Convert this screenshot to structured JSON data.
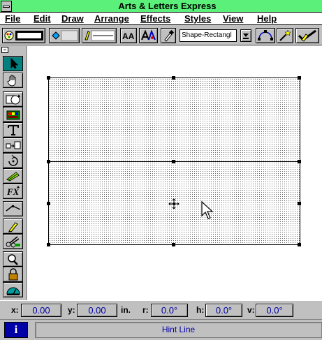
{
  "window": {
    "title": "Arts & Letters Express"
  },
  "menubar": [
    {
      "key": "file",
      "label": "File"
    },
    {
      "key": "edit",
      "label": "Edit"
    },
    {
      "key": "draw",
      "label": "Draw"
    },
    {
      "key": "arrange",
      "label": "Arrange"
    },
    {
      "key": "effects",
      "label": "Effects"
    },
    {
      "key": "styles",
      "label": "Styles"
    },
    {
      "key": "view",
      "label": "View"
    },
    {
      "key": "help",
      "label": "Help"
    }
  ],
  "toolbar": {
    "shape_select_value": "Shape-Rectangl",
    "text_size_button_label": "AA"
  },
  "coordinates": {
    "x_label": "x:",
    "x_value": "0.00",
    "y_label": "y:",
    "y_value": "0.00",
    "unit_label": "in.",
    "r_label": "r:",
    "r_value": "0.0°",
    "h_label": "h:",
    "h_value": "0.0°",
    "v_label": "v:",
    "v_value": "0.0°"
  },
  "status": {
    "info_label": "i",
    "hint_text": "Hint Line"
  },
  "colors": {
    "titlebar": "#5af07a",
    "selected_tool": "#008080",
    "value_text": "#0000a8"
  }
}
